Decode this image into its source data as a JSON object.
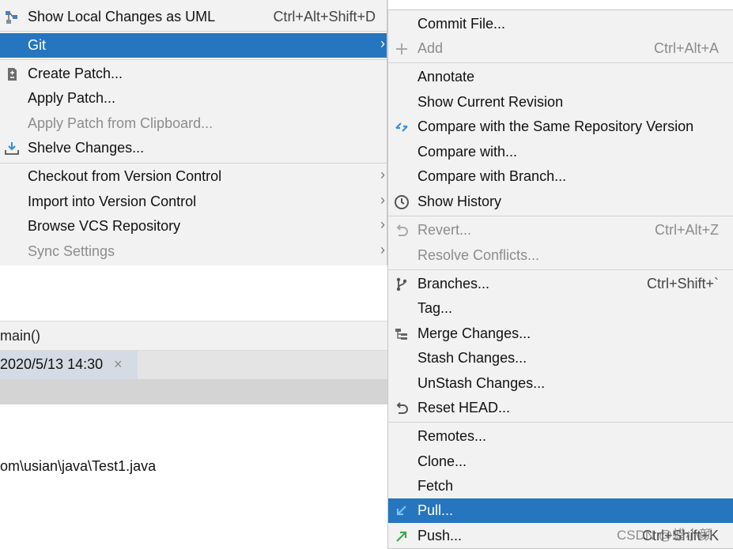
{
  "editor": {
    "breadcrumb": "main()",
    "tab_label": "2020/5/13 14:30",
    "tab_close": "×",
    "path": "om\\usian\\java\\Test1.java"
  },
  "left_menu": {
    "items": [
      {
        "label": "Show Local Changes as UML",
        "shortcut": "Ctrl+Alt+Shift+D",
        "icon": "uml-icon"
      },
      {
        "label": "Git",
        "submenu": true,
        "selected": true
      },
      {
        "label": "Create Patch...",
        "icon": "patch-icon"
      },
      {
        "label": "Apply Patch..."
      },
      {
        "label": "Apply Patch from Clipboard...",
        "disabled": true
      },
      {
        "label": "Shelve Changes...",
        "icon": "shelve-icon"
      },
      {
        "label": "Checkout from Version Control",
        "submenu": true
      },
      {
        "label": "Import into Version Control",
        "submenu": true
      },
      {
        "label": "Browse VCS Repository",
        "submenu": true
      },
      {
        "label": "Sync Settings",
        "submenu": true,
        "disabled": true
      }
    ],
    "arrow": "›"
  },
  "git_menu": {
    "items": [
      {
        "label": "Commit File..."
      },
      {
        "label": "Add",
        "shortcut": "Ctrl+Alt+A",
        "disabled": true,
        "icon": "plus-icon"
      },
      {
        "label": "Annotate"
      },
      {
        "label": "Show Current Revision"
      },
      {
        "label": "Compare with the Same Repository Version",
        "icon": "compare-icon"
      },
      {
        "label": "Compare with..."
      },
      {
        "label": "Compare with Branch..."
      },
      {
        "label": "Show History",
        "icon": "clock-icon"
      },
      {
        "label": "Revert...",
        "shortcut": "Ctrl+Alt+Z",
        "disabled": true,
        "icon": "revert-icon"
      },
      {
        "label": "Resolve Conflicts...",
        "disabled": true
      },
      {
        "label": "Branches...",
        "shortcut": "Ctrl+Shift+`",
        "icon": "branch-icon"
      },
      {
        "label": "Tag..."
      },
      {
        "label": "Merge Changes...",
        "icon": "merge-icon"
      },
      {
        "label": "Stash Changes..."
      },
      {
        "label": "UnStash Changes..."
      },
      {
        "label": "Reset HEAD...",
        "icon": "reset-icon"
      },
      {
        "label": "Remotes..."
      },
      {
        "label": "Clone..."
      },
      {
        "label": "Fetch"
      },
      {
        "label": "Pull...",
        "selected": true,
        "icon": "pull-icon"
      },
      {
        "label": "Push...",
        "shortcut": "Ctrl+Shift+K",
        "icon": "push-icon"
      }
    ]
  },
  "watermark": "CSDN @蜡小颜",
  "colors": {
    "selection": "#2675bf",
    "menu_bg": "#f2f2f2",
    "disabled": "#8c8c8c"
  }
}
